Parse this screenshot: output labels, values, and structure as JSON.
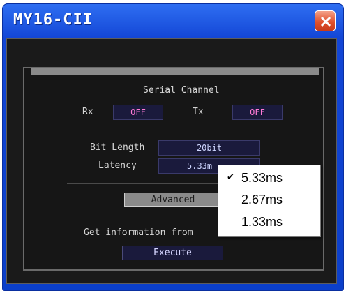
{
  "window": {
    "title": "MY16-CII"
  },
  "serial": {
    "heading": "Serial Channel",
    "rx_label": "Rx",
    "rx_value": "OFF",
    "tx_label": "Tx",
    "tx_value": "OFF"
  },
  "settings": {
    "bit_length_label": "Bit Length",
    "bit_length_value": "20bit",
    "latency_label": "Latency",
    "latency_value": "5.33m"
  },
  "advanced_button": "Advanced",
  "info": {
    "label": "Get information from",
    "execute_button": "Execute"
  },
  "latency_menu": {
    "items": [
      {
        "label": "5.33ms",
        "checked": true,
        "check_glyph": "✔"
      },
      {
        "label": "2.67ms",
        "checked": false
      },
      {
        "label": "1.33ms",
        "checked": false
      }
    ]
  },
  "colors": {
    "title_bar": "#1346d6",
    "close_button": "#e0522e",
    "panel_bg": "#161616",
    "field_bg": "#1a1a3c",
    "off_text": "#ff7ad6"
  }
}
